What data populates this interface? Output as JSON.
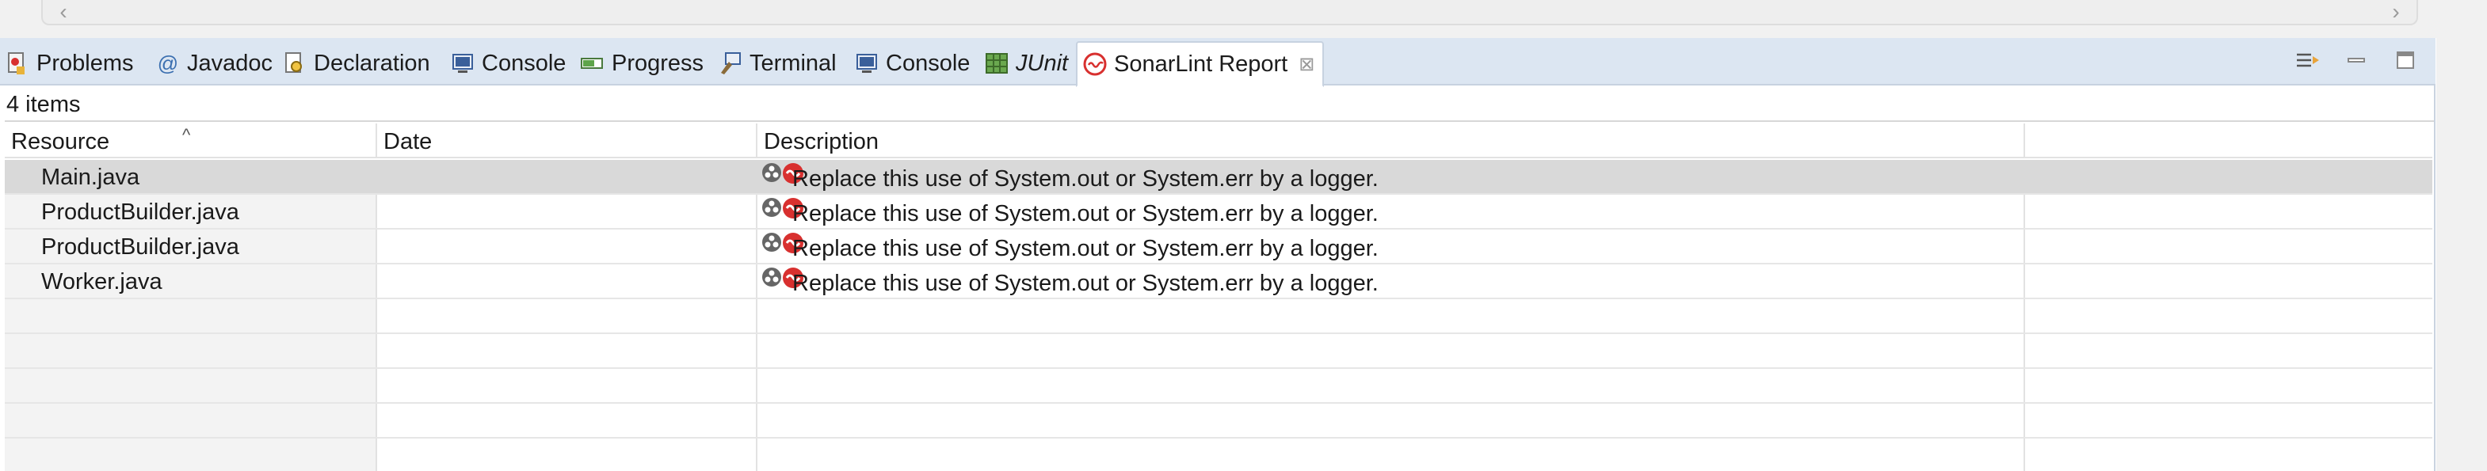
{
  "tabs": [
    {
      "id": "problems",
      "label": "Problems",
      "icon": "problems-icon"
    },
    {
      "id": "javadoc",
      "label": "Javadoc",
      "icon": "javadoc-icon"
    },
    {
      "id": "declaration",
      "label": "Declaration",
      "icon": "declaration-icon"
    },
    {
      "id": "console1",
      "label": "Console",
      "icon": "console-icon"
    },
    {
      "id": "progress",
      "label": "Progress",
      "icon": "progress-icon"
    },
    {
      "id": "terminal",
      "label": "Terminal",
      "icon": "terminal-icon"
    },
    {
      "id": "console2",
      "label": "Console",
      "icon": "console-icon"
    },
    {
      "id": "junit",
      "label": "JUnit",
      "icon": "junit-icon"
    },
    {
      "id": "sonarlint",
      "label": "SonarLint Report",
      "icon": "sonarlint-icon",
      "active": true
    }
  ],
  "view": {
    "item_count": "4 items"
  },
  "table": {
    "columns": [
      "Resource",
      "Date",
      "Description"
    ],
    "sorted_column": "Resource",
    "rows": [
      {
        "resource": "Main.java",
        "date": "",
        "description": "Replace this use of System.out or System.err by a logger.",
        "selected": true
      },
      {
        "resource": "ProductBuilder.java",
        "date": "",
        "description": "Replace this use of System.out or System.err by a logger."
      },
      {
        "resource": "ProductBuilder.java",
        "date": "",
        "description": "Replace this use of System.out or System.err by a logger."
      },
      {
        "resource": "Worker.java",
        "date": "",
        "description": "Replace this use of System.out or System.err by a logger."
      }
    ]
  },
  "colors": {
    "tabbar_bg": "#dce6f2",
    "selected_row": "#d9d9d9",
    "sonar_red": "#d8302f"
  }
}
